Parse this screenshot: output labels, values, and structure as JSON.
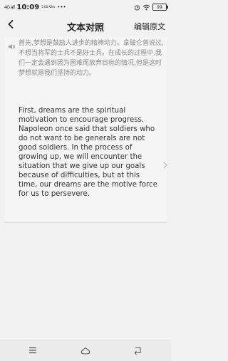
{
  "status_bar": {
    "signal": "4G all",
    "time": "10:09",
    "network_speed": "5.00 KB/s",
    "more": "•••",
    "battery": "99"
  },
  "header": {
    "back": "back-icon",
    "title": "文本对照",
    "edit_label": "编辑原文"
  },
  "content": {
    "source_text": "首先,梦想是鼓励人进步的精神动力。拿破仑曾说过,不想当将军的士兵不是好士兵。在成长的过程中,我们一定会遇到因为困难而放弃目标的情况,但是这时梦想就是我们坚持的动力。",
    "translated_text": "First, dreams are the spiritual motivation to encourage progress. Napoleon once said that soldiers who do not want to be generals are not good soldiers. In the process of growing up, we will encounter the situation that we give up our goals because of difficulties, but at this time, our dreams are the motive force for us to persevere."
  },
  "nav": {
    "menu": "menu-icon",
    "home": "home-icon",
    "back": "back-nav-icon"
  }
}
